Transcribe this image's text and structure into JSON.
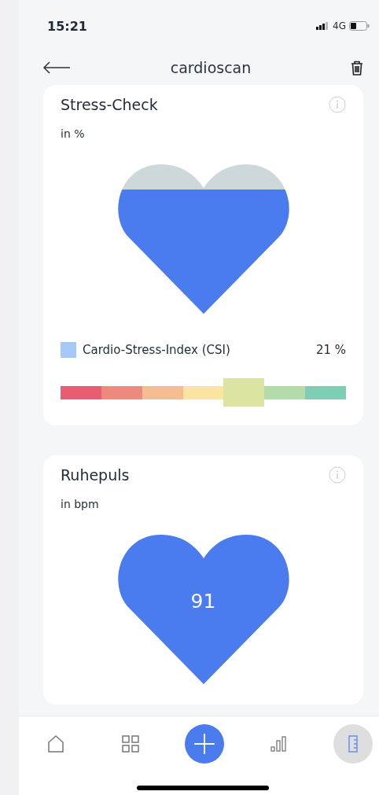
{
  "status_bar": {
    "time": "15:21",
    "network": "4G"
  },
  "header": {
    "title": "cardioscan"
  },
  "cards": [
    {
      "kind": "stress",
      "title": "Stress-Check",
      "unit": "in %",
      "legend": {
        "label": "Cardio-Stress-Index (CSI)",
        "value": "21 %",
        "color": "#a4c8f8"
      },
      "scale": [
        {
          "color": "#e85d73",
          "selected": false
        },
        {
          "color": "#ee8a7d",
          "selected": false
        },
        {
          "color": "#f3bd8f",
          "selected": false
        },
        {
          "color": "#f9e4a2",
          "selected": false
        },
        {
          "color": "#dde3a2",
          "selected": true
        },
        {
          "color": "#b4dbaa",
          "selected": false
        },
        {
          "color": "#7ccfb4",
          "selected": false
        }
      ]
    },
    {
      "kind": "pulse",
      "title": "Ruhepuls",
      "unit": "in bpm",
      "value": "91"
    }
  ],
  "nav": [
    {
      "kind": "home",
      "selected": false
    },
    {
      "kind": "grid",
      "selected": false
    },
    {
      "kind": "add",
      "selected": false
    },
    {
      "kind": "chart",
      "selected": false
    },
    {
      "kind": "ruler",
      "selected": true
    }
  ]
}
